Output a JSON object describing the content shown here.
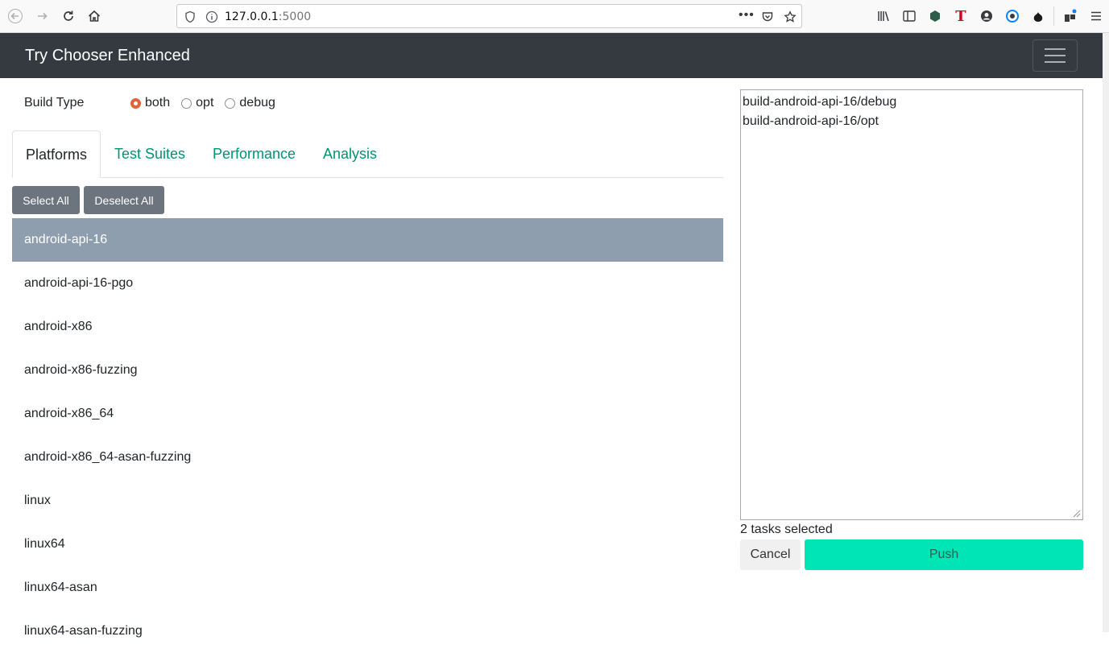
{
  "browser": {
    "url_host": "127.0.0.1",
    "url_port": ":5000"
  },
  "navbar": {
    "brand": "Try Chooser Enhanced"
  },
  "build_type": {
    "label": "Build Type",
    "options": [
      "both",
      "opt",
      "debug"
    ],
    "selected": "both"
  },
  "tabs": [
    "Platforms",
    "Test Suites",
    "Performance",
    "Analysis"
  ],
  "active_tab": "Platforms",
  "actions": {
    "select_all": "Select All",
    "deselect_all": "Deselect All"
  },
  "platforms": [
    "android-api-16",
    "android-api-16-pgo",
    "android-x86",
    "android-x86-fuzzing",
    "android-x86_64",
    "android-x86_64-asan-fuzzing",
    "linux",
    "linux64",
    "linux64-asan",
    "linux64-asan-fuzzing"
  ],
  "selected_platform": "android-api-16",
  "tasks": {
    "lines": [
      "build-android-api-16/debug",
      "build-android-api-16/opt"
    ],
    "count_text": "2 tasks selected"
  },
  "footer_buttons": {
    "cancel": "Cancel",
    "push": "Push"
  },
  "colors": {
    "navbar": "#343a40",
    "tab_link": "#009374",
    "selected_row": "#8e9eae",
    "push": "#00e5b5",
    "radio_checked": "#e0633a"
  }
}
